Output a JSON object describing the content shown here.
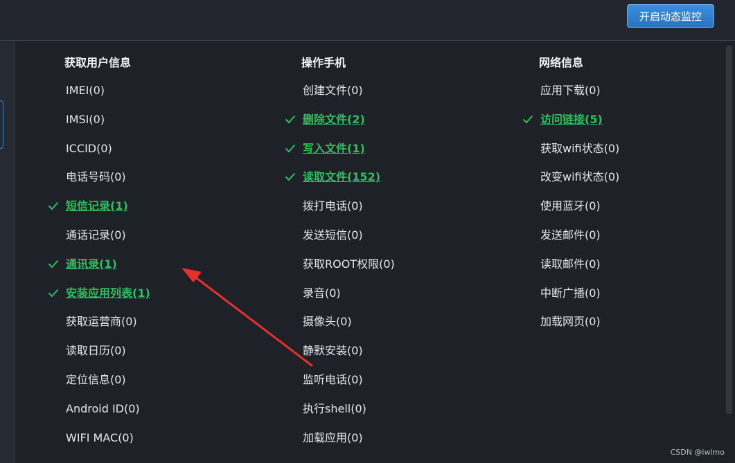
{
  "header": {
    "monitor_button": "开启动态监控"
  },
  "columns": [
    {
      "title": "获取用户信息",
      "items": [
        {
          "label": "IMEI(0)",
          "active": false
        },
        {
          "label": "IMSI(0)",
          "active": false
        },
        {
          "label": "ICCID(0)",
          "active": false
        },
        {
          "label": "电话号码(0)",
          "active": false
        },
        {
          "label": "短信记录(1)",
          "active": true
        },
        {
          "label": "通话记录(0)",
          "active": false
        },
        {
          "label": "通讯录(1)",
          "active": true
        },
        {
          "label": "安装应用列表(1)",
          "active": true
        },
        {
          "label": "获取运营商(0)",
          "active": false
        },
        {
          "label": "读取日历(0)",
          "active": false
        },
        {
          "label": "定位信息(0)",
          "active": false
        },
        {
          "label": "Android ID(0)",
          "active": false
        },
        {
          "label": "WIFI MAC(0)",
          "active": false
        }
      ]
    },
    {
      "title": "操作手机",
      "items": [
        {
          "label": "创建文件(0)",
          "active": false
        },
        {
          "label": "删除文件(2)",
          "active": true
        },
        {
          "label": "写入文件(1)",
          "active": true
        },
        {
          "label": "读取文件(152)",
          "active": true
        },
        {
          "label": "拨打电话(0)",
          "active": false
        },
        {
          "label": "发送短信(0)",
          "active": false
        },
        {
          "label": "获取ROOT权限(0)",
          "active": false
        },
        {
          "label": "录音(0)",
          "active": false
        },
        {
          "label": "摄像头(0)",
          "active": false
        },
        {
          "label": "静默安装(0)",
          "active": false
        },
        {
          "label": "监听电话(0)",
          "active": false
        },
        {
          "label": "执行shell(0)",
          "active": false
        },
        {
          "label": "加载应用(0)",
          "active": false
        }
      ]
    },
    {
      "title": "网络信息",
      "items": [
        {
          "label": "应用下载(0)",
          "active": false
        },
        {
          "label": "访问链接(5)",
          "active": true
        },
        {
          "label": "获取wifi状态(0)",
          "active": false
        },
        {
          "label": "改变wifi状态(0)",
          "active": false
        },
        {
          "label": "使用蓝牙(0)",
          "active": false
        },
        {
          "label": "发送邮件(0)",
          "active": false
        },
        {
          "label": "读取邮件(0)",
          "active": false
        },
        {
          "label": "中断广播(0)",
          "active": false
        },
        {
          "label": "加载网页(0)",
          "active": false
        }
      ]
    }
  ],
  "watermark": "CSDN @iwlmo",
  "colors": {
    "active": "#2fbf5f",
    "accent": "#3b8fdc",
    "annotation_arrow": "#e8302a"
  },
  "icons": {
    "check": "check-icon"
  }
}
